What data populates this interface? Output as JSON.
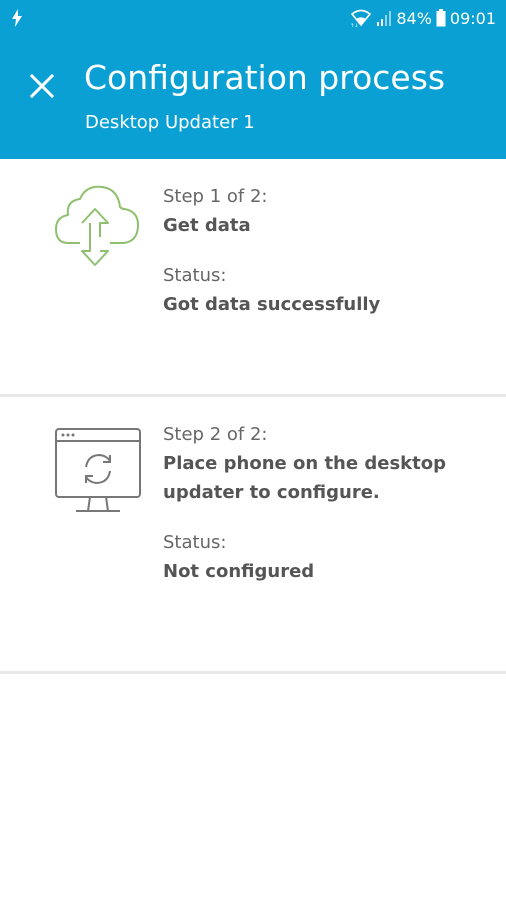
{
  "status_bar": {
    "battery_percent": "84%",
    "time": "09:01",
    "icons": [
      "flash-icon",
      "wifi-icon",
      "signal-icon",
      "battery-icon"
    ]
  },
  "app_bar": {
    "title": "Configuration process",
    "subtitle": "Desktop Updater 1",
    "close_icon": "close-icon",
    "background_color": "#0aa0d3"
  },
  "steps": [
    {
      "icon": "cloud-sync-icon",
      "step_label": "Step 1 of 2:",
      "step_title": "Get data",
      "status_label": "Status:",
      "status_value": "Got data successfully",
      "icon_color": "#8fc06f"
    },
    {
      "icon": "desktop-updater-icon",
      "step_label": "Step 2 of 2:",
      "step_title": "Place phone on the desktop updater to configure.",
      "status_label": "Status:",
      "status_value": "Not configured",
      "icon_color": "#777777"
    }
  ]
}
